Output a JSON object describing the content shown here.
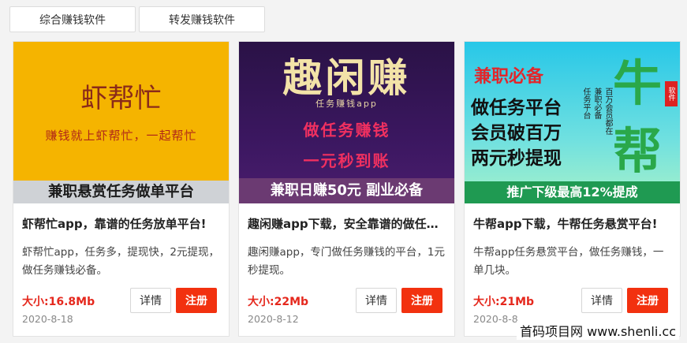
{
  "tabs": [
    {
      "label": "综合赚钱软件"
    },
    {
      "label": "转发赚钱软件"
    }
  ],
  "cards": [
    {
      "thumb": {
        "logo": "虾帮忙",
        "slogan": "赚钱就上虾帮忙，一起帮忙",
        "bar": "兼职悬赏任务做单平台"
      },
      "title": "虾帮忙app，靠谱的任务放单平台!",
      "desc": "虾帮忙app，任务多，提现快，2元提现，做任务赚钱必备。",
      "size": "大小:16.8Mb",
      "date": "2020-8-18",
      "detail_label": "详情",
      "register_label": "注册"
    },
    {
      "thumb": {
        "big": "趣闲赚",
        "sub": "任务赚钱app",
        "line1": "做任务赚钱",
        "line2": "一元秒到账",
        "bar": "兼职日赚50元 副业必备"
      },
      "title": "趣闲赚app下载，安全靠谱的做任务赚钱平台!",
      "desc": "趣闲赚app，专门做任务赚钱的平台，1元秒提现。",
      "size": "大小:22Mb",
      "date": "2020-8-12",
      "detail_label": "详情",
      "register_label": "注册"
    },
    {
      "thumb": {
        "red": "兼职必备",
        "line1": "做任务平台",
        "line2": "会员破百万",
        "line3": "两元秒提现",
        "vert1": "兼职必备",
        "vert2": "百万会员都在",
        "vert3": "任务平台",
        "niu": "牛",
        "bang": "帮",
        "seal": "软件",
        "bar": "推广下级最高12%提成"
      },
      "title": "牛帮app下载，牛帮任务悬赏平台!",
      "desc": "牛帮app任务悬赏平台，做任务赚钱，一单几块。",
      "size": "大小:21Mb",
      "date": "2020-8-8",
      "detail_label": "详情",
      "register_label": "注册"
    }
  ],
  "watermark": "首码项目网  www.shenli.cc"
}
